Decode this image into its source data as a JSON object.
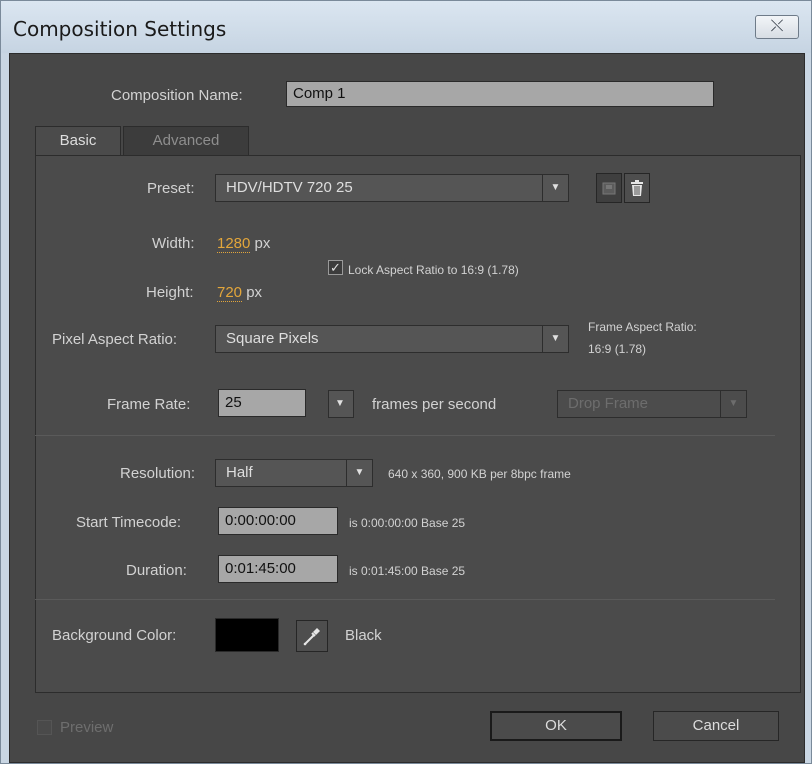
{
  "window": {
    "title": "Composition Settings",
    "close_glyph": "⤬"
  },
  "comp_name": {
    "label": "Composition Name:",
    "value": "Comp 1"
  },
  "tabs": [
    {
      "label": "Basic",
      "active": true
    },
    {
      "label": "Advanced",
      "active": false
    }
  ],
  "preset": {
    "label": "Preset:",
    "value": "HDV/HDTV 720 25"
  },
  "width": {
    "label": "Width:",
    "value": "1280",
    "unit": "px"
  },
  "height": {
    "label": "Height:",
    "value": "720",
    "unit": "px"
  },
  "lock_aspect": {
    "label": "Lock Aspect Ratio to 16:9 (1.78)",
    "checked": true
  },
  "pixel_aspect": {
    "label": "Pixel Aspect Ratio:",
    "value": "Square Pixels"
  },
  "frame_aspect": {
    "label": "Frame Aspect Ratio:",
    "value": "16:9 (1.78)"
  },
  "frame_rate": {
    "label": "Frame Rate:",
    "value": "25",
    "unit": "frames per second",
    "drop_frame": "Drop Frame"
  },
  "resolution": {
    "label": "Resolution:",
    "value": "Half",
    "info": "640 x 360, 900 KB per 8bpc frame"
  },
  "start_timecode": {
    "label": "Start Timecode:",
    "value": "0:00:00:00",
    "info": "is 0:00:00:00  Base 25"
  },
  "duration": {
    "label": "Duration:",
    "value": "0:01:45:00",
    "info": "is 0:01:45:00  Base 25"
  },
  "background": {
    "label": "Background Color:",
    "color": "#000000",
    "name": "Black"
  },
  "footer": {
    "preview_label": "Preview",
    "ok_label": "OK",
    "cancel_label": "Cancel"
  },
  "colors": {
    "panel": "#474747",
    "field": "#a7a7a7",
    "accent": "#e3a63b"
  },
  "icons": {
    "close": "close-icon",
    "dropdown": "chevron-down-icon",
    "save_preset": "save-preset-icon",
    "delete_preset": "trash-icon",
    "eyedropper": "eyedropper-icon",
    "checkbox": "checkmark-icon"
  }
}
